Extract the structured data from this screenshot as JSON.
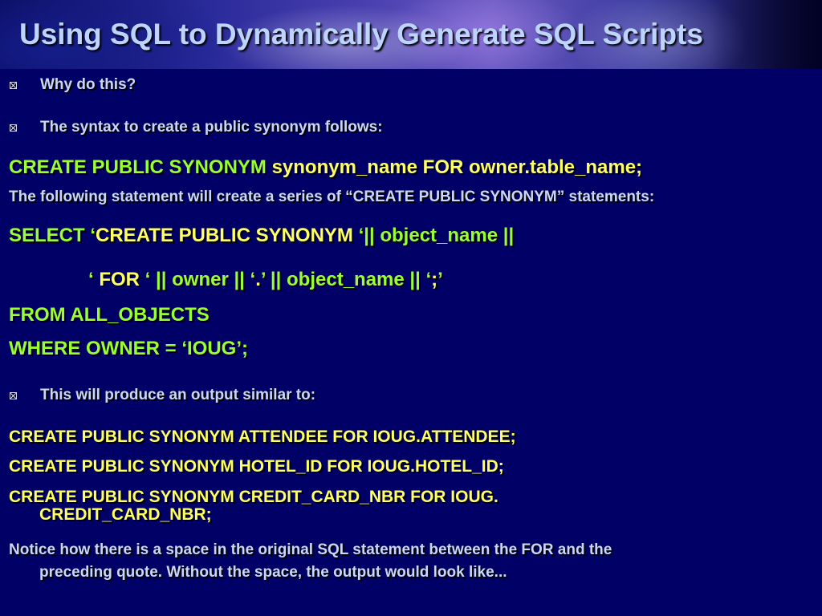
{
  "slide": {
    "title": "Using SQL to Dynamically Generate SQL Scripts",
    "bullet1": "Why do this?",
    "bullet2": "The syntax to create a public synonym follows:",
    "syntax": {
      "part_a": "CREATE PUBLIC SYNONYM ",
      "part_b": "synonym_name FOR owner.table_name;"
    },
    "following": "The following statement will create a series of “CREATE PUBLIC SYNONYM” statements:",
    "select_line1": {
      "a": "SELECT ‘",
      "b": "CREATE PUBLIC SYNONYM",
      "c": " ‘|| object_name ||"
    },
    "select_line2": {
      "a": "‘ ",
      "b": "FOR",
      "c": " ‘ || owner || ‘",
      "d": ".",
      "e": "’ || object_name || ‘",
      "f": ";",
      "g": "’"
    },
    "from_line": "FROM ALL_OBJECTS",
    "where_line": "WHERE OWNER = ‘IOUG’;",
    "bullet3": "This will produce an output similar to:",
    "output1": "CREATE PUBLIC SYNONYM ATTENDEE FOR IOUG.ATTENDEE;",
    "output2": "CREATE PUBLIC SYNONYM HOTEL_ID FOR IOUG.HOTEL_ID;",
    "output3_line1": "CREATE PUBLIC SYNONYM CREDIT_CARD_NBR FOR IOUG.",
    "output3_line2": "CREDIT_CARD_NBR;",
    "notice_line1": "Notice how there is a space in the original SQL statement between the FOR and the",
    "notice_line2": "preceding quote. Without the space, the output would look like..."
  }
}
